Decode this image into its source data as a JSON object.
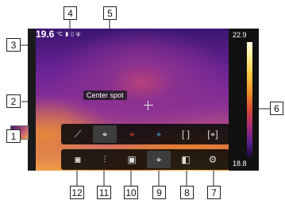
{
  "status": {
    "temperature": "19.6",
    "unit": "°C"
  },
  "scale": {
    "max": "22.9",
    "min": "18.8"
  },
  "tooltip": "Center spot",
  "callouts": [
    "1",
    "2",
    "3",
    "4",
    "5",
    "6",
    "7",
    "8",
    "9",
    "10",
    "11",
    "12"
  ],
  "top_tools": [
    {
      "name": "no-measurement-icon",
      "glyph": "⟋"
    },
    {
      "name": "center-spot-icon",
      "glyph": "⌖"
    },
    {
      "name": "hot-spot-icon",
      "glyph": "⌖"
    },
    {
      "name": "cold-spot-icon",
      "glyph": "⌖"
    },
    {
      "name": "user-spot-icon",
      "glyph": "⌜⌟"
    },
    {
      "name": "user-area-icon",
      "glyph": "⌜⌟"
    }
  ],
  "bottom_tools": [
    {
      "name": "camera-icon",
      "glyph": "📷"
    },
    {
      "name": "adjust-sliders-icon",
      "glyph": "⫶"
    },
    {
      "name": "image-mode-icon",
      "glyph": "▣"
    },
    {
      "name": "measurement-icon",
      "glyph": "⌖"
    },
    {
      "name": "color-palette-icon",
      "glyph": "▮"
    },
    {
      "name": "settings-icon",
      "glyph": "⚙"
    }
  ]
}
